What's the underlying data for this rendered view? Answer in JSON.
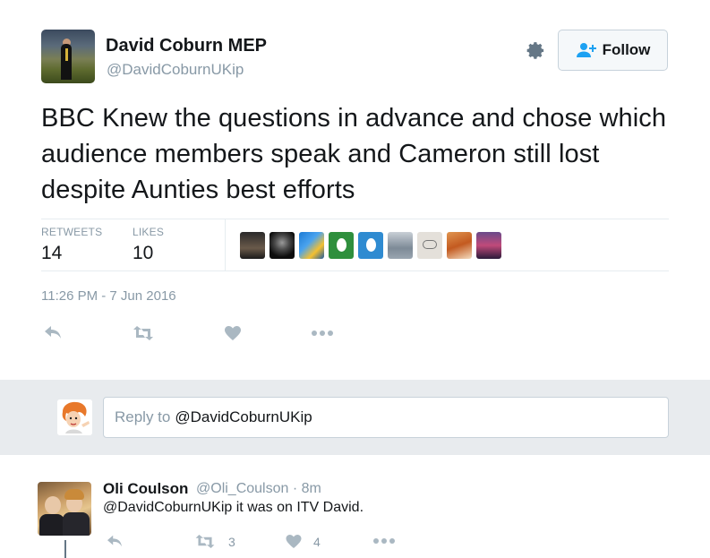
{
  "tweet": {
    "author_name": "David Coburn MEP",
    "author_handle": "@DavidCoburnUKip",
    "follow_label": "Follow",
    "text": "BBC Knew the questions in advance and chose which audience members speak and Cameron still lost despite Aunties best efforts",
    "stats": {
      "retweets_label": "RETWEETS",
      "retweets_value": "14",
      "likes_label": "LIKES",
      "likes_value": "10"
    },
    "timestamp": "11:26 PM - 7 Jun 2016",
    "actions": [
      "reply-icon",
      "retweet-icon",
      "like-icon",
      "more-icon"
    ],
    "likers": [
      "liker-1",
      "liker-2",
      "liker-3",
      "liker-4",
      "liker-5",
      "liker-6",
      "liker-7",
      "liker-8",
      "liker-9"
    ]
  },
  "reply_box": {
    "placeholder": "Reply to",
    "mention": "@DavidCoburnUKip"
  },
  "reply": {
    "name": "Oli Coulson",
    "handle_time": "@Oli_Coulson · 8m",
    "text": "@DavidCoburnUKip it was on ITV David.",
    "retweet_count": "3",
    "like_count": "4"
  },
  "colors": {
    "text": "#14171a",
    "muted": "#8899a6",
    "follow_icon": "#1da1f2",
    "reply_bg": "#e8ebee"
  }
}
